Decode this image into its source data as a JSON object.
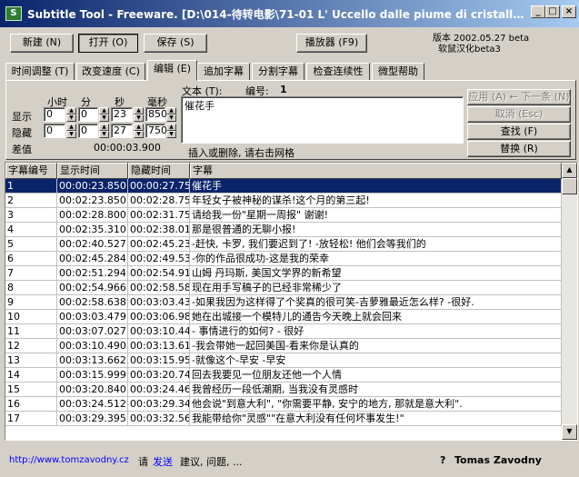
{
  "window": {
    "title": "Subtitle Tool - Freeware. [D:\\014-待转电影\\71-01 L' Uccello dalle piume di cristallo-...",
    "icon": "subtitle-tool-app-icon",
    "icon_glyph": "S",
    "minimize": "_",
    "maximize": "□",
    "close": "×"
  },
  "toolbar": {
    "new_label": "新建 (N)",
    "open_label": "打开 (O)",
    "save_label": "保存 (S)",
    "player_label": "播放器 (F9)",
    "version_line1": "版本 2002.05.27 beta",
    "version_line2": "软鼠汉化beta3"
  },
  "tabs": [
    "时间调整 (T)",
    "改变速度 (C)",
    "编辑 (E)",
    "追加字幕",
    "分割字幕",
    "检查连续性",
    "微型帮助"
  ],
  "active_tab_index": 2,
  "editor": {
    "hour_label": "小时",
    "minute_label": "分",
    "second_label": "秒",
    "ms_label": "毫秒",
    "show_label": "显示",
    "hide_label": "隐藏",
    "diff_label": "差值",
    "show_values": {
      "h": "0",
      "m": "0",
      "s": "23",
      "ms": "850"
    },
    "hide_values": {
      "h": "0",
      "m": "0",
      "s": "27",
      "ms": "750"
    },
    "diff_value": "00:00:03.900",
    "text_label": "文本 (T):",
    "number_label": "编号:",
    "number_value": "1",
    "text_value": "催花手",
    "hint": "插入或删除, 请右击网格",
    "apply_label": "应用 (A) ← 下一条 (N)",
    "cancel_label": "取消 (Esc)",
    "find_label": "查找 (F)",
    "replace_label": "替换 (R)"
  },
  "grid": {
    "columns": [
      "字幕编号",
      "显示时间",
      "隐藏时间",
      "字幕"
    ],
    "selected_row": 0,
    "rows": [
      [
        "1",
        "00:00:23.850",
        "00:00:27.75",
        "催花手"
      ],
      [
        "2",
        "00:02:23.850",
        "00:02:28.75",
        "年轻女子被神秘的谋杀!这个月的第三起!"
      ],
      [
        "3",
        "00:02:28.800",
        "00:02:31.75",
        "请给我一份\"星期一周报\" 谢谢!"
      ],
      [
        "4",
        "00:02:35.310",
        "00:02:38.01",
        "那是很普通的无聊小报!"
      ],
      [
        "5",
        "00:02:40.527",
        "00:02:45.23",
        "-赶快, 卡罗, 我们要迟到了! -放轻松!  他们会等我们的"
      ],
      [
        "6",
        "00:02:45.284",
        "00:02:49.53",
        "-你的作品很成功-这是我的荣幸"
      ],
      [
        "7",
        "00:02:51.294",
        "00:02:54.91",
        "山姆 丹玛斯, 美国文学界的新希望"
      ],
      [
        "8",
        "00:02:54.966",
        "00:02:58.58",
        "现在用手写稿子的已经非常稀少了"
      ],
      [
        "9",
        "00:02:58.638",
        "00:03:03.43",
        "-如果我因为这样得了个奖真的很可笑-吉萝雅最近怎么样?  -很好."
      ],
      [
        "10",
        "00:03:03.479",
        "00:03:06.98",
        "她在出城接一个模特儿的通告今天晚上就会回来"
      ],
      [
        "11",
        "00:03:07.027",
        "00:03:10.44",
        "- 事情进行的如何? - 很好"
      ],
      [
        "12",
        "00:03:10.490",
        "00:03:13.61",
        "-我会带她一起回美国-看来你是认真的"
      ],
      [
        "13",
        "00:03:13.662",
        "00:03:15.95",
        "-就像这个-早安  -早安"
      ],
      [
        "14",
        "00:03:15.999",
        "00:03:20.74",
        "回去我要见一位朋友还他一个人情"
      ],
      [
        "15",
        "00:03:20.840",
        "00:03:24.46",
        "我曾经历一段低潮期, 当我没有灵感时"
      ],
      [
        "16",
        "00:03:24.512",
        "00:03:29.34",
        "他会说\"到意大利\", \"你需要平静, 安宁的地方, 那就是意大利\"."
      ],
      [
        "17",
        "00:03:29.395",
        "00:03:32.56",
        "我能带给你\"灵感\"\"在意大利没有任何坏事发生!\""
      ]
    ]
  },
  "status": {
    "url": "http://www.tomzavodny.cz",
    "prefix": "请",
    "send_link": "发送",
    "suffix": "建议, 问题, ...",
    "help_glyph": "?",
    "author": "Tomas Zavodny"
  }
}
